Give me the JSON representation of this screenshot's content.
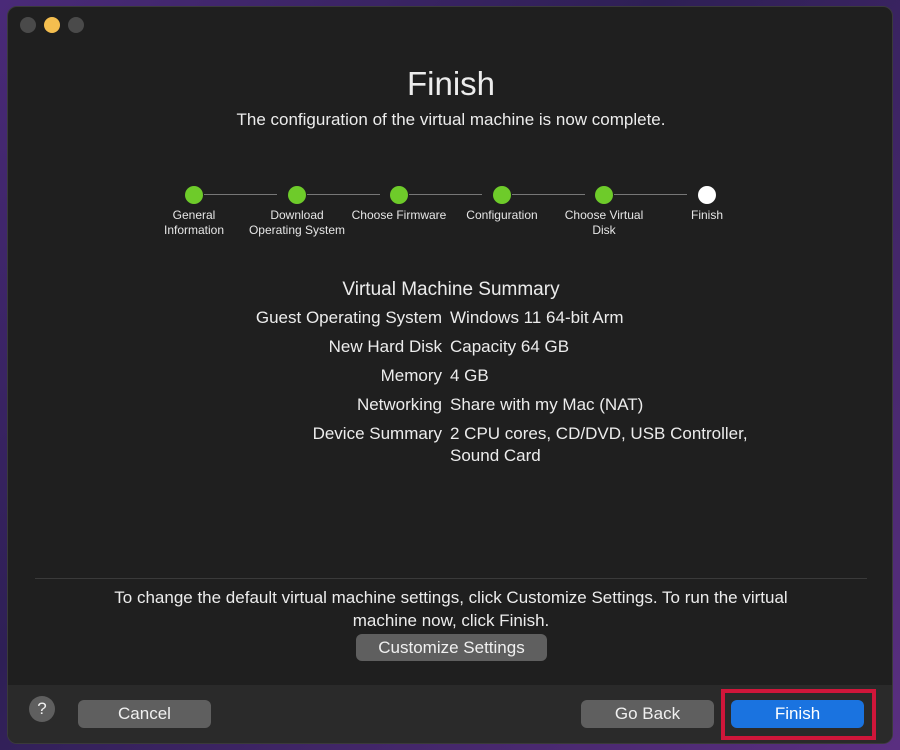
{
  "window": {
    "title": "Finish",
    "subtitle": "The configuration of the virtual machine is now complete."
  },
  "steps": [
    {
      "label": "General Information",
      "state": "complete"
    },
    {
      "label": "Download Operating System",
      "state": "complete"
    },
    {
      "label": "Choose Firmware",
      "state": "complete"
    },
    {
      "label": "Configuration",
      "state": "complete"
    },
    {
      "label": "Choose Virtual Disk",
      "state": "complete"
    },
    {
      "label": "Finish",
      "state": "current"
    }
  ],
  "summary": {
    "title": "Virtual Machine Summary",
    "rows": [
      {
        "key": "Guest Operating System",
        "value": "Windows 11 64-bit Arm"
      },
      {
        "key": "New Hard Disk",
        "value": "Capacity 64 GB"
      },
      {
        "key": "Memory",
        "value": "4 GB"
      },
      {
        "key": "Networking",
        "value": "Share with my Mac (NAT)"
      },
      {
        "key": "Device Summary",
        "value": "2 CPU cores, CD/DVD, USB Controller, Sound Card"
      }
    ]
  },
  "hint": "To change the default virtual machine settings, click Customize Settings. To run the virtual machine now, click Finish.",
  "buttons": {
    "customize": "Customize Settings",
    "help": "?",
    "cancel": "Cancel",
    "go_back": "Go Back",
    "finish": "Finish"
  },
  "colors": {
    "step_complete": "#6ecb2a",
    "step_current": "#ffffff",
    "primary_button": "#1a73e0",
    "highlight_outline": "#d0163a"
  },
  "icons": {
    "close": "close-icon",
    "minimize": "minimize-icon",
    "zoom": "zoom-icon",
    "help": "help-icon"
  }
}
